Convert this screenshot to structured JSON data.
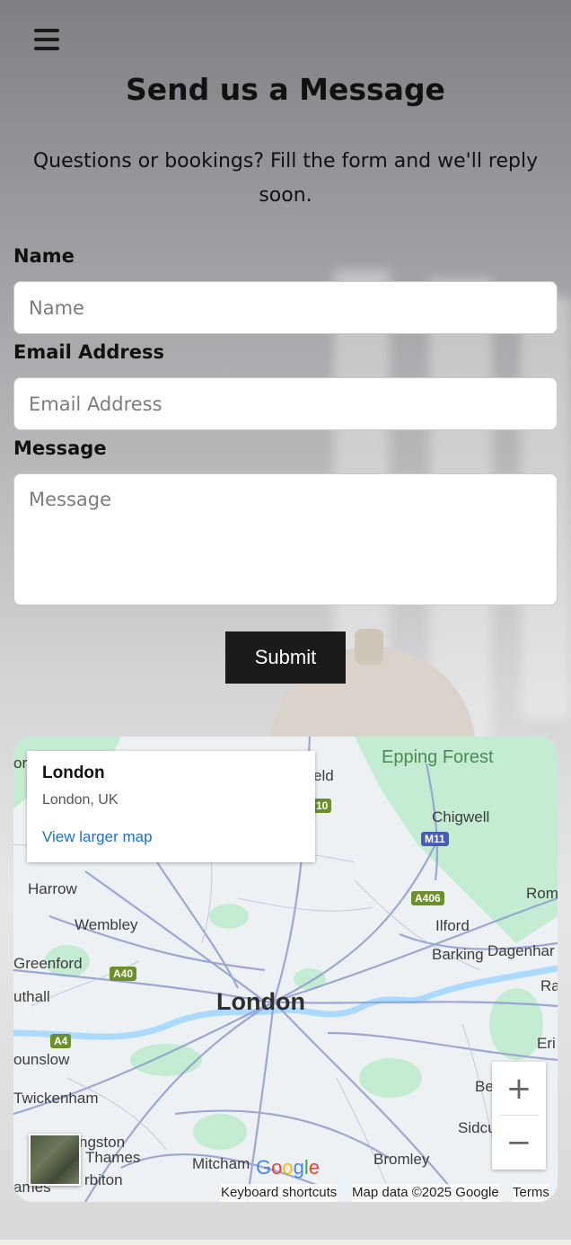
{
  "header": {
    "menu_icon": "hamburger-menu-icon",
    "title": "Send us a Message",
    "subtitle": "Questions or bookings? Fill the form and we'll reply soon."
  },
  "form": {
    "name_label": "Name",
    "name_placeholder": "Name",
    "email_label": "Email Address",
    "email_placeholder": "Email Address",
    "message_label": "Message",
    "message_placeholder": "Message",
    "submit_label": "Submit"
  },
  "map": {
    "info_title": "London",
    "info_subtitle": "London, UK",
    "info_link": "View larger map",
    "center_label": "London",
    "place_labels": [
      "Epping Forest",
      "Chigwell",
      "Harrow",
      "Wembley",
      "Ilford",
      "Barking",
      "Greenford",
      "Twickenham",
      "Mitcham",
      "Bromley",
      "Sidcu",
      "Rom",
      "Dagenhar",
      "Ra",
      "Eri",
      "Be",
      "uthall",
      "ounslow",
      "ngston",
      "Thames",
      "rbiton",
      "ames",
      "ord",
      "eld"
    ],
    "road_badges": [
      "M11",
      "A406",
      "A40",
      "A4",
      "10"
    ],
    "zoom_in": "+",
    "zoom_out": "−",
    "logo": "Google",
    "keyboard_shortcuts": "Keyboard shortcuts",
    "map_data": "Map data ©2025 Google",
    "terms": "Terms",
    "colors": {
      "water": "#aadaff",
      "park": "#c3ecd2",
      "road": "#8e9ccf",
      "link": "#1a6fd4"
    }
  },
  "colors": {
    "submit_bg": "#1b1b1b",
    "text": "#111111"
  }
}
